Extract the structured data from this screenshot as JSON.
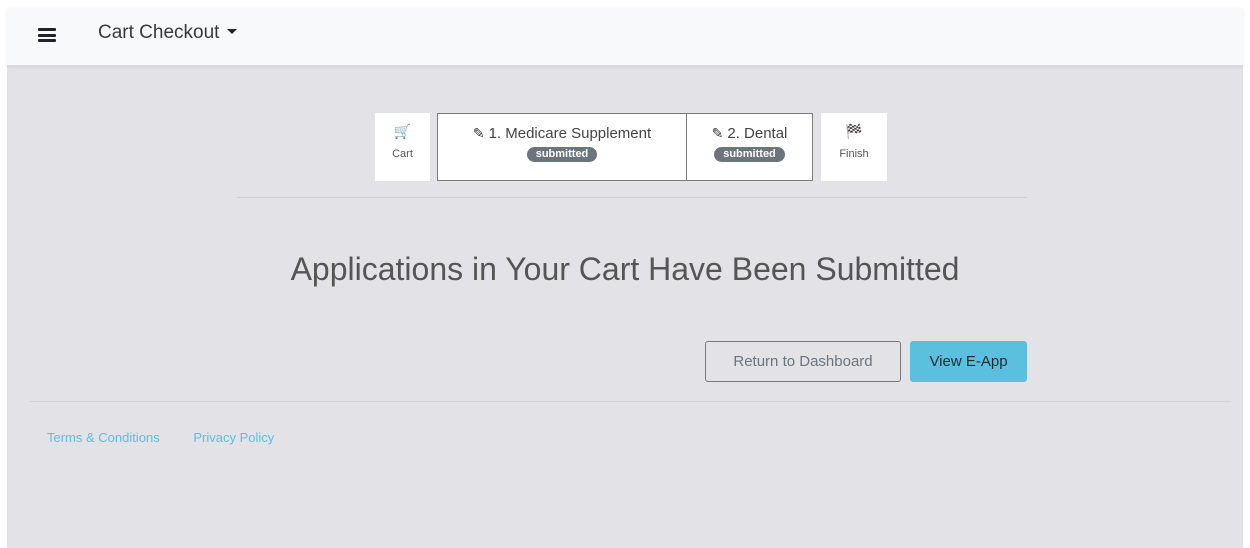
{
  "navbar": {
    "title": "Cart Checkout",
    "menu_icon": "hamburger-icon",
    "dropdown_icon": "caret-down-icon"
  },
  "steps": {
    "cart": {
      "label": "Cart",
      "icon": "shopping-cart-icon"
    },
    "apps": [
      {
        "label": "1. Medicare Supplement",
        "status": "submitted",
        "icon": "signature-icon"
      },
      {
        "label": "2. Dental",
        "status": "submitted",
        "icon": "signature-icon"
      }
    ],
    "finish": {
      "label": "Finish",
      "icon": "checkered-flag-icon"
    }
  },
  "main": {
    "heading": "Applications in Your Cart Have Been Submitted",
    "return_label": "Return to Dashboard",
    "view_label": "View E-App"
  },
  "footer": {
    "terms": "Terms & Conditions",
    "privacy": "Privacy Policy"
  },
  "colors": {
    "background": "#e2e2e7",
    "accent": "#5bc0de",
    "badge": "#6c757d"
  }
}
